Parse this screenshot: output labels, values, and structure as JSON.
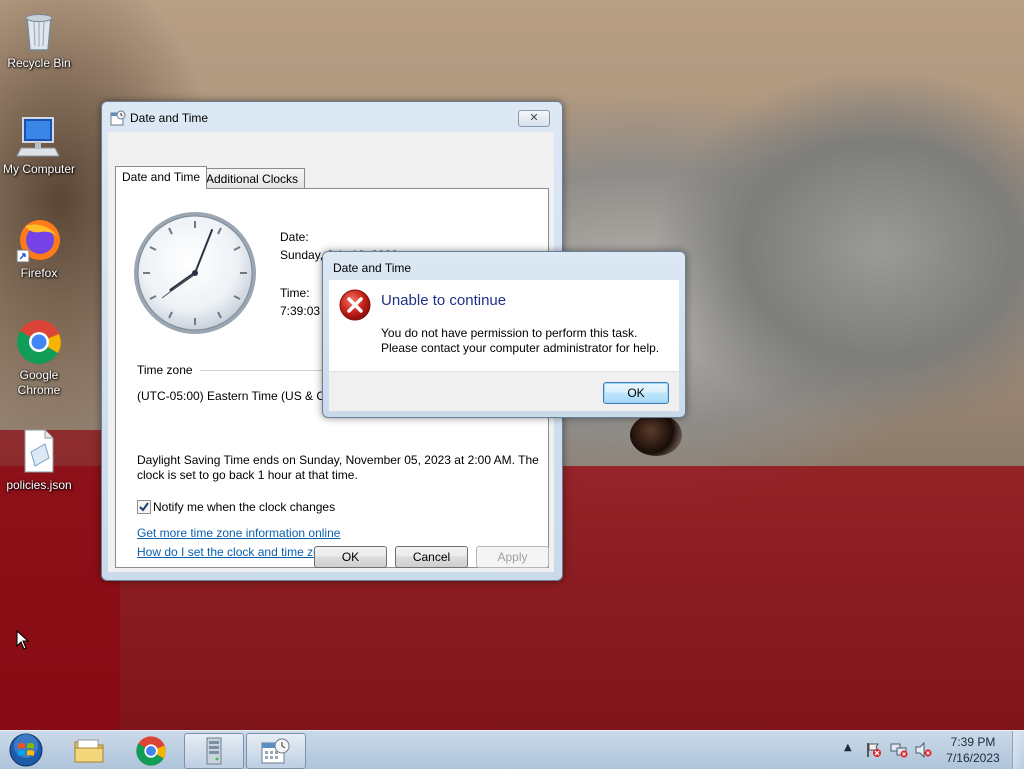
{
  "desktop": {
    "icons": [
      {
        "label": "Recycle Bin",
        "icon": "recycle-bin-icon"
      },
      {
        "label": "My Computer",
        "icon": "computer-icon"
      },
      {
        "label": "Firefox",
        "icon": "firefox-icon"
      },
      {
        "label": "Google Chrome",
        "icon": "chrome-icon"
      },
      {
        "label": "policies.json",
        "icon": "json-file-icon"
      }
    ]
  },
  "datetime_window": {
    "title": "Date and Time",
    "close": "✕",
    "tabs": [
      {
        "label": "Date and Time",
        "active": true
      },
      {
        "label": "Additional Clocks",
        "active": false
      }
    ],
    "date_label": "Date:",
    "date_value": "Sunday, July 16, 2023",
    "time_label": "Time:",
    "time_value": "7:39:03 PM",
    "timezone_heading": "Time zone",
    "timezone_value": "(UTC-05:00) Eastern Time (US & Canada)",
    "dst_line1": "Daylight Saving Time ends on Sunday, November 05, 2023 at 2:00 AM. The",
    "dst_line2": "clock is set to go back 1 hour at that time.",
    "notify_label": "Notify me when the clock changes",
    "notify_checked": true,
    "link1": "Get more time zone information online",
    "link2": "How do I set the clock and time zone?",
    "ok": "OK",
    "cancel": "Cancel",
    "apply": "Apply"
  },
  "error_dialog": {
    "title": "Date and Time",
    "heading": "Unable to continue",
    "line1": "You do not have permission to perform this task.",
    "line2": "Please contact your computer administrator for help.",
    "ok": "OK",
    "heading_color": "#1e3287"
  },
  "taskbar": {
    "clock_time": "7:39 PM",
    "clock_date": "7/16/2023",
    "pinned": [
      "start-orb-icon",
      "explorer-folder-icon",
      "chrome-icon",
      "server-manager-icon",
      "datetime-control-icon"
    ]
  }
}
